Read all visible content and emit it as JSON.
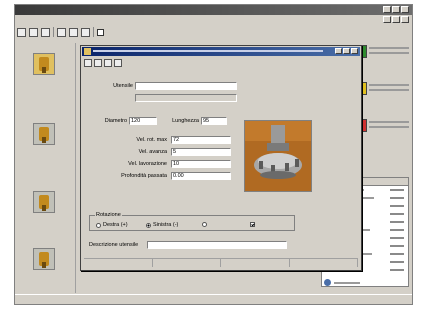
{
  "app": {
    "title": "",
    "toolbar": {
      "check_label": ""
    },
    "statusbar": {
      "text": ""
    },
    "left_panel": {
      "tool_slots": [
        "tool-1",
        "tool-2",
        "tool-3",
        "tool-4"
      ]
    },
    "right_panel": {
      "items": [
        {
          "icon": "tool-holder-icon",
          "color": "#2e8b2e"
        },
        {
          "icon": "tool-holder-icon",
          "color": "#e0c020"
        },
        {
          "icon": "tool-holder-icon",
          "color": "#d03030"
        }
      ]
    }
  },
  "dialog": {
    "title": "",
    "fields": {
      "utensile": {
        "label": "Utensile",
        "value": ""
      },
      "second": {
        "label": "",
        "value": ""
      },
      "diametro": {
        "label": "Diametro",
        "value": "120"
      },
      "lunghezza": {
        "label": "Lunghezza",
        "value": "95"
      },
      "vel_rot_max": {
        "label": "",
        "value": "72"
      },
      "vel_avanza": {
        "label": "Vel. avanza",
        "value": "5"
      },
      "vel_lavorazione": {
        "label": "Vel. lavorazione",
        "value": "10"
      },
      "profondita": {
        "label": "Profondità passata",
        "value": "0.00"
      }
    },
    "image_label": "",
    "rotation": {
      "group_label": "Rotazione",
      "options": [
        {
          "label": "Destra (+)",
          "selected": false
        },
        {
          "label": "Sinistra (-)",
          "selected": true
        },
        {
          "label": "",
          "selected": false
        }
      ],
      "checkbox": {
        "label": "",
        "checked": true
      }
    },
    "description": {
      "label": "Descrizione utensile",
      "value": ""
    }
  }
}
